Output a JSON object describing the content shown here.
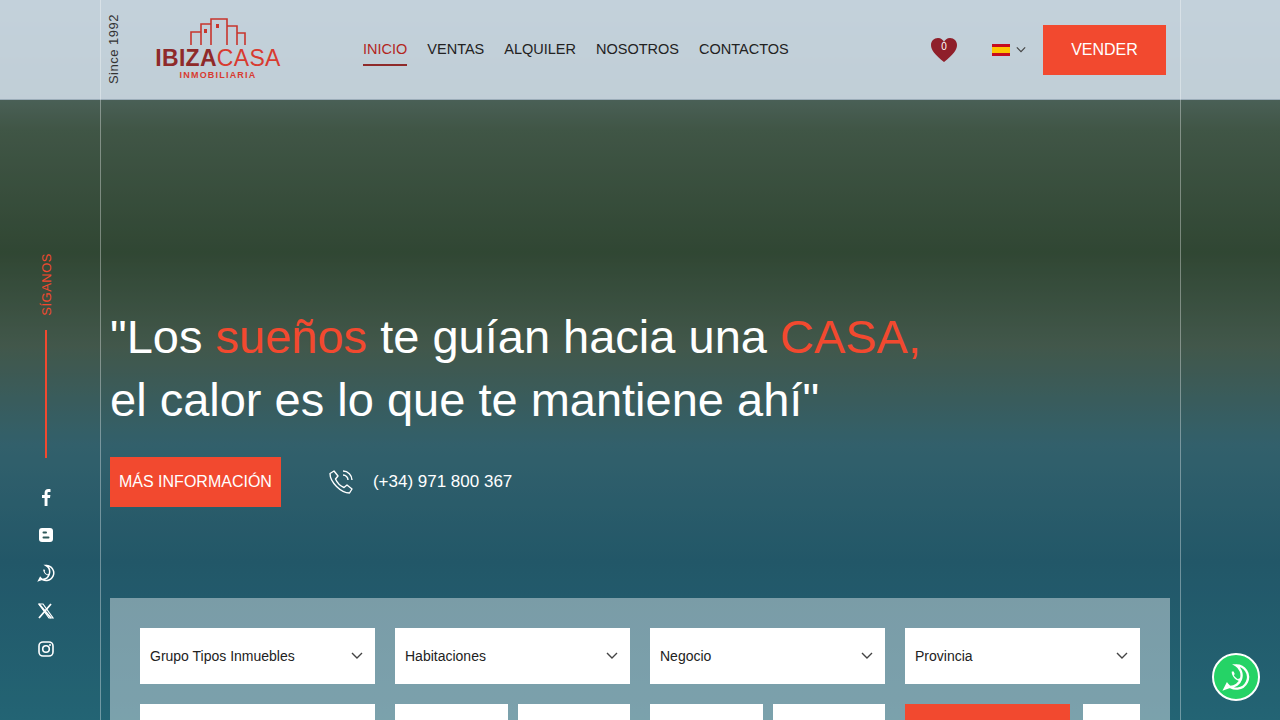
{
  "header": {
    "since": "Since 1992",
    "logo": {
      "main_left": "IBIZA",
      "main_right": "CASA",
      "sub": "INMOBILIARIA"
    },
    "nav": [
      {
        "label": "INICIO",
        "selected": true
      },
      {
        "label": "VENTAS",
        "selected": false
      },
      {
        "label": "ALQUILER",
        "selected": false
      },
      {
        "label": "NOSOTROS",
        "selected": false
      },
      {
        "label": "CONTACTOS",
        "selected": false
      }
    ],
    "favorites_count": "0",
    "sell_button": "VENDER"
  },
  "sidebar": {
    "follow_label": "SÍGANOS",
    "social": [
      {
        "kind": "facebook"
      },
      {
        "kind": "blogger"
      },
      {
        "kind": "whatsapp"
      },
      {
        "kind": "x"
      },
      {
        "kind": "instagram"
      }
    ]
  },
  "hero": {
    "headline": [
      [
        {
          "text": "\"Los ",
          "highlight": false
        },
        {
          "text": "sueños",
          "highlight": true
        },
        {
          "text": " te guían hacia una ",
          "highlight": false
        },
        {
          "text": "CASA,",
          "highlight": true
        }
      ],
      [
        {
          "text": "el calor es lo que te mantiene ahí\"",
          "highlight": false
        }
      ]
    ],
    "cta_button": "MÁS INFORMACIÓN",
    "phone": "(+34) 971 800 367"
  },
  "search": {
    "fields": [
      {
        "placeholder": "Grupo Tipos Inmuebles"
      },
      {
        "placeholder": "Habitaciones"
      },
      {
        "placeholder": "Negocio"
      },
      {
        "placeholder": "Provincia"
      }
    ]
  }
}
